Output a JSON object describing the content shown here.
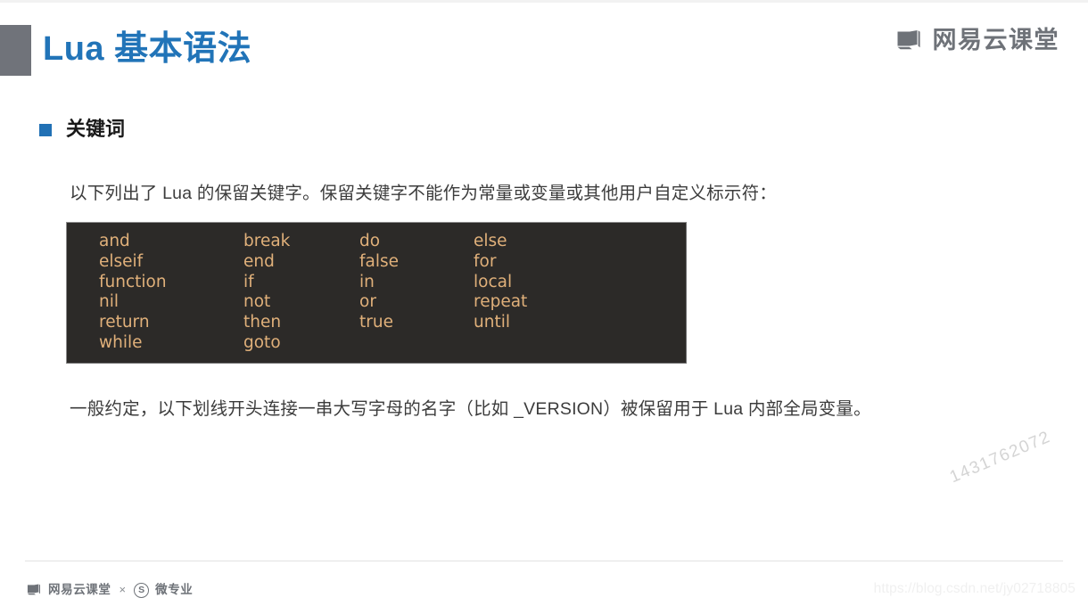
{
  "header": {
    "title": "Lua 基本语法",
    "title_color": "#2174b8",
    "marker_color": "#70737a",
    "brand_name": "网易云课堂",
    "brand_icon": "open-book-icon",
    "brand_color": "#6e7278"
  },
  "section": {
    "bullet_icon": "square-bullet-icon",
    "bullet_color": "#2171b5",
    "heading": "关键词"
  },
  "body": {
    "intro_paragraph": "以下列出了 Lua 的保留关键字。保留关键字不能作为常量或变量或其他用户自定义标示符：",
    "note_paragraph": "一般约定，以下划线开头连接一串大写字母的名字（比如 _VERSION）被保留用于 Lua 内部全局变量。"
  },
  "code_block": {
    "background_color": "#2c2a28",
    "text_color": "#e0b07a",
    "columns": [
      [
        "and",
        "elseif",
        "function",
        "nil",
        "return",
        "while"
      ],
      [
        "break",
        "end",
        "if",
        "not",
        "then",
        "goto"
      ],
      [
        "do",
        "false",
        "in",
        "or",
        "true"
      ],
      [
        "else",
        "for",
        "local",
        "repeat",
        "until"
      ]
    ]
  },
  "watermarks": {
    "number": "1431762072",
    "url": "https://blog.csdn.net/jy02718805"
  },
  "footer": {
    "icon": "open-book-icon",
    "brand": "网易云课堂",
    "separator": "×",
    "badge_letter": "S",
    "badge_icon": "circled-s-icon",
    "sub_brand": "微专业"
  }
}
